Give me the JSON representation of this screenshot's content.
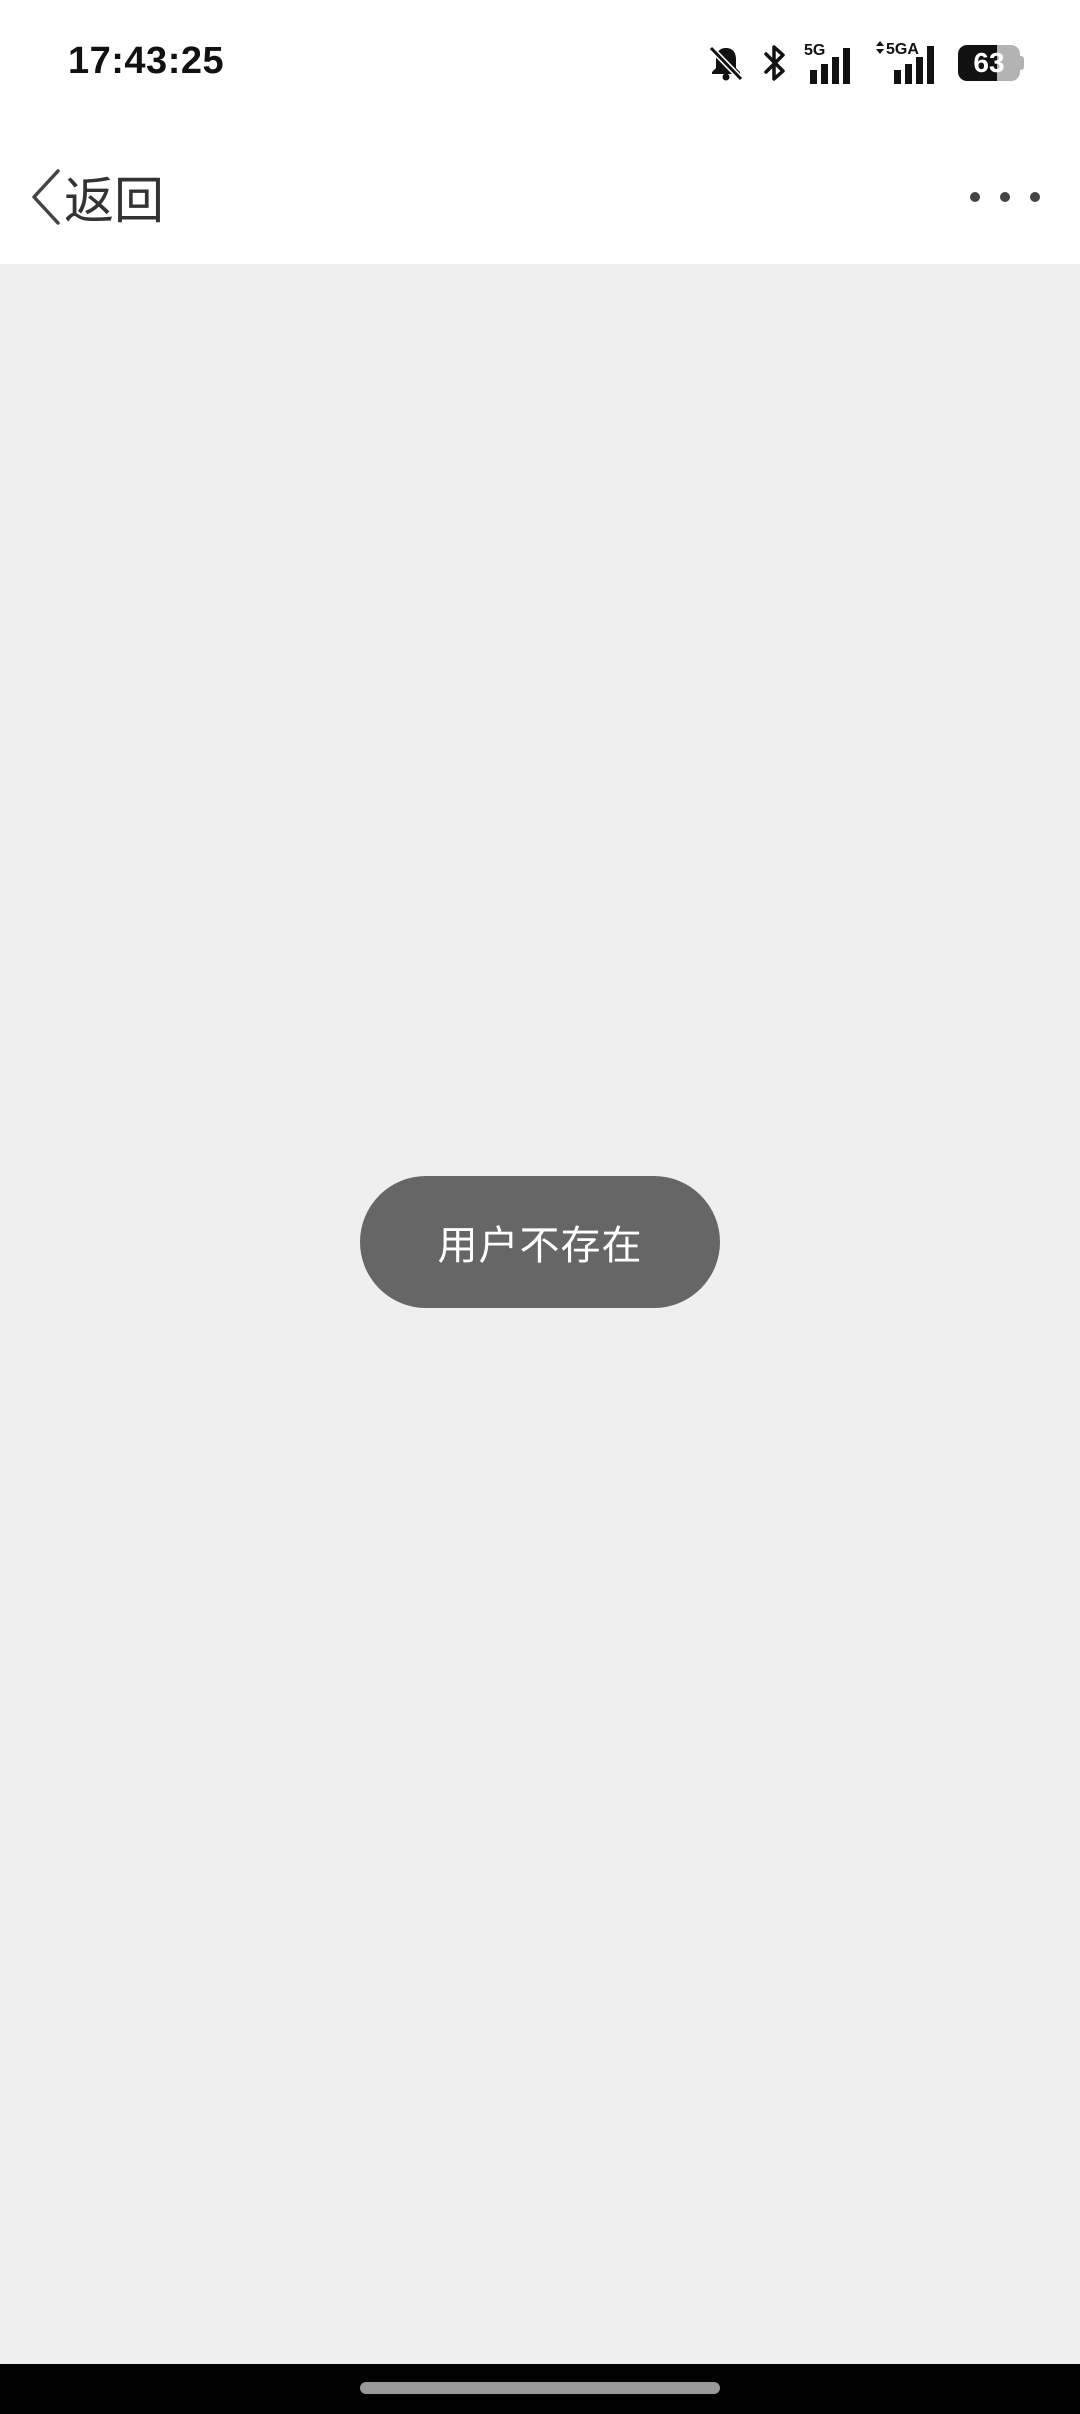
{
  "status_bar": {
    "time": "17:43:25",
    "battery_percent": 63,
    "battery_label": "63",
    "network_1": "5G",
    "network_2": "5GA",
    "icons": [
      "bell-muted-icon",
      "bluetooth-icon",
      "signal-5g-icon",
      "signal-5ga-icon",
      "battery-icon"
    ]
  },
  "nav": {
    "back_label": "返回",
    "back_icon": "chevron-left-icon",
    "more_icon": "more-dots-icon"
  },
  "toast": {
    "message": "用户不存在"
  },
  "colors": {
    "background": "#efefef",
    "toast_bg": "#666666",
    "nav_bg": "#ffffff"
  }
}
